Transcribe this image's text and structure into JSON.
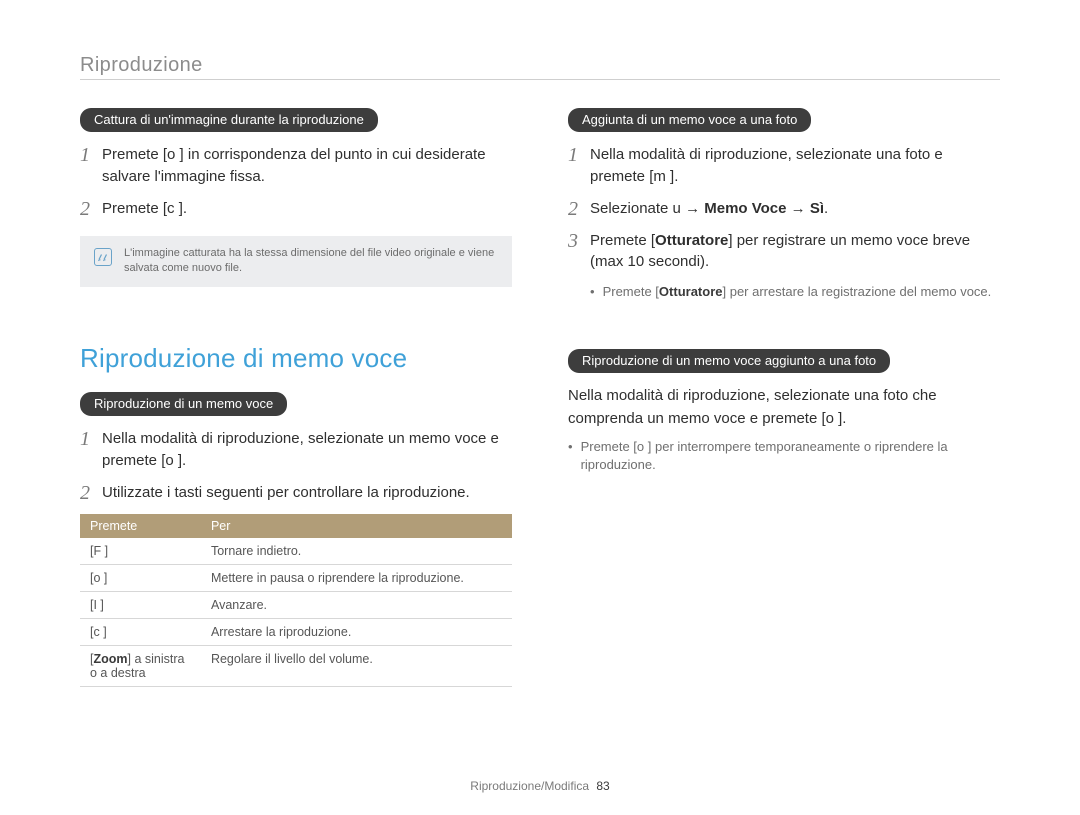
{
  "header": {
    "section": "Riproduzione"
  },
  "left": {
    "pill1": "Cattura di un'immagine durante la riproduzione",
    "step1": "Premete [o   ] in corrispondenza del punto in cui desiderate salvare l'immagine ﬁssa.",
    "step2": "Premete [c   ].",
    "note": "L'immagine catturata ha la stessa dimensione del ﬁle video originale e viene salvata come nuovo ﬁle.",
    "heading": "Riproduzione di memo voce",
    "pill2": "Riproduzione di un memo voce",
    "step2_1": "Nella modalità di riproduzione, selezionate un memo voce e premete [o   ].",
    "step2_2": "Utilizzate i tasti seguenti per controllare la riproduzione.",
    "table": {
      "head": {
        "c1": "Premete",
        "c2": "Per"
      },
      "rows": [
        {
          "c1": "[F   ]",
          "c2": "Tornare indietro."
        },
        {
          "c1": "[o   ]",
          "c2": "Mettere in pausa o riprendere la riproduzione."
        },
        {
          "c1": "[I    ]",
          "c2": "Avanzare."
        },
        {
          "c1": "[c   ]",
          "c2": "Arrestare la riproduzione."
        },
        {
          "c1_pre": "[",
          "c1_bold": "Zoom",
          "c1_post": "] a sinistra o a destra",
          "c2": "Regolare il livello del volume."
        }
      ]
    }
  },
  "right": {
    "pill1": "Aggiunta di un memo voce a una foto",
    "step1": "Nella modalità di riproduzione, selezionate una foto e premete [m      ].",
    "step2_pre": "Selezionate u     → ",
    "step2_bold": "Memo Voce → Sì",
    "step2_post": ".",
    "step3_pre": "Premete [",
    "step3_bold": "Otturatore",
    "step3_post": "] per registrare un memo voce breve (max 10 secondi).",
    "sub1_pre": "Premete [",
    "sub1_bold": "Otturatore",
    "sub1_post": "] per arrestare la registrazione del memo voce.",
    "pill2": "Riproduzione di un memo voce aggiunto a una foto",
    "para": "Nella modalità di riproduzione, selezionate una foto che comprenda un memo voce e premete [o   ].",
    "sub2": "Premete [o   ] per interrompere temporaneamente o riprendere la riproduzione."
  },
  "footer": {
    "breadcrumb": "Riproduzione/Modiﬁca",
    "page": "83"
  }
}
